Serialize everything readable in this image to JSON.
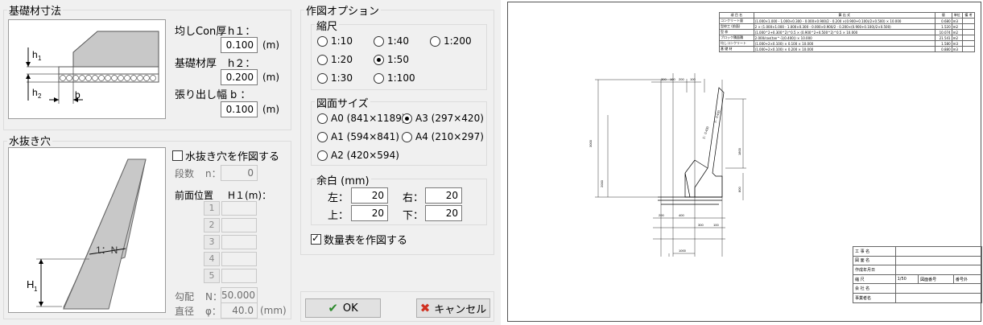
{
  "footing": {
    "title": "基礎材寸法",
    "h1_label": "均しCon厚",
    "h1_sym": "h１：",
    "h1_value": "0.100",
    "h1_unit": "(m)",
    "h2_label": "基礎材厚",
    "h2_sym": "h２：",
    "h2_value": "0.200",
    "h2_unit": "(m)",
    "b_label": "張り出し幅",
    "b_sym": "b ：",
    "b_value": "0.100",
    "b_unit": "(m)",
    "diagram": {
      "h1": "h",
      "h1_sub": "1",
      "h2": "h",
      "h2_sub": "2",
      "b": "b"
    }
  },
  "drain": {
    "title": "水抜き穴",
    "check_label": "水抜き穴を作図する",
    "checked": false,
    "stages_label": "段数",
    "stages_sym": "n：",
    "stages_value": "0",
    "front_label": "前面位置",
    "front_sym": "H１(m)：",
    "rows": [
      "1",
      "2",
      "3",
      "4",
      "5"
    ],
    "slope_label": "勾配",
    "slope_sym": "N：",
    "slope_value": "50.000",
    "dia_label": "直径",
    "dia_sym": "φ：",
    "dia_value": "40.0",
    "dia_unit": "(mm)",
    "diagram": {
      "ratio": "1：N",
      "H": "H",
      "H_sub": "1"
    }
  },
  "options": {
    "title": "作図オプション",
    "scale": {
      "title": "縮尺",
      "options": [
        "1:10",
        "1:40",
        "1:200",
        "1:20",
        "1:50",
        "1:30",
        "1:100"
      ],
      "selected": "1:50"
    },
    "paper": {
      "title": "図面サイズ",
      "options": [
        "A0 (841×1189)",
        "A3 (297×420)",
        "A1 (594×841)",
        "A4 (210×297)",
        "A2 (420×594)"
      ],
      "selected": "A3 (297×420)"
    },
    "margin": {
      "title": "余白 (mm)",
      "left_label": "左：",
      "left_value": "20",
      "right_label": "右：",
      "right_value": "20",
      "top_label": "上：",
      "top_value": "20",
      "bottom_label": "下：",
      "bottom_value": "20"
    },
    "table_check_label": "数量表を作図する",
    "table_checked": true
  },
  "buttons": {
    "ok": "OK",
    "cancel": "キャンセル"
  },
  "preview": {
    "table": [
      [
        "項 目 名",
        "算 出 式",
        "値",
        "単位",
        "備 考"
      ],
      [
        "コンクリート量",
        "(1.000×1.000 - 1.000×0.300 - 0.000×0.900/2 - 0.200 ×(0.900+0.100)/2×0.500) × 10.000",
        "0.680",
        "m3",
        ""
      ],
      [
        "型枠工 (前面)",
        "2 × (1.000×1.000 - 1.000×0.300 - 0.000×0.900/2 - 0.200×(0.900+0.100)/2×0.500)",
        "1.520",
        "m2",
        ""
      ],
      [
        "型 枠",
        "(1.000^2+0.300^2)^0.5 × (0.900^2+0.500^2)^0.5 × 10.000",
        "10.074",
        "m2",
        ""
      ],
      [
        "ブロック積面積",
        "2.000/cos(tan^-1(0.400)) × 10.000",
        "21.541",
        "m2",
        ""
      ],
      [
        "均しコンクリート",
        "(1.000+2×0.100) × 0.100 × 10.000",
        "1.580",
        "m3",
        ""
      ],
      [
        "基 礎 材",
        "(1.000+2×0.100) × 0.200 × 10.000",
        "0.880",
        "m3",
        ""
      ]
    ],
    "title_block": [
      [
        "工 事 名",
        ""
      ],
      [
        "図 面 名",
        ""
      ],
      [
        "作成年月日",
        ""
      ],
      [
        "縮 尺",
        "1/50",
        "図面番号",
        "番号外"
      ],
      [
        "会 社 名",
        ""
      ],
      [
        "事業者名",
        ""
      ]
    ],
    "dims": {
      "top1": "300",
      "top2": "100",
      "top3": "200",
      "top4": "100",
      "left_total": "3000",
      "left_upper": "2000",
      "right_upper": "1800",
      "right_lower": "800",
      "slope": "1：0.400",
      "slope2": "1：0.400",
      "bottom1": "200",
      "bottom2": "400",
      "bottom3": "300",
      "bottom4": "100",
      "bottom_total": "1000"
    }
  }
}
